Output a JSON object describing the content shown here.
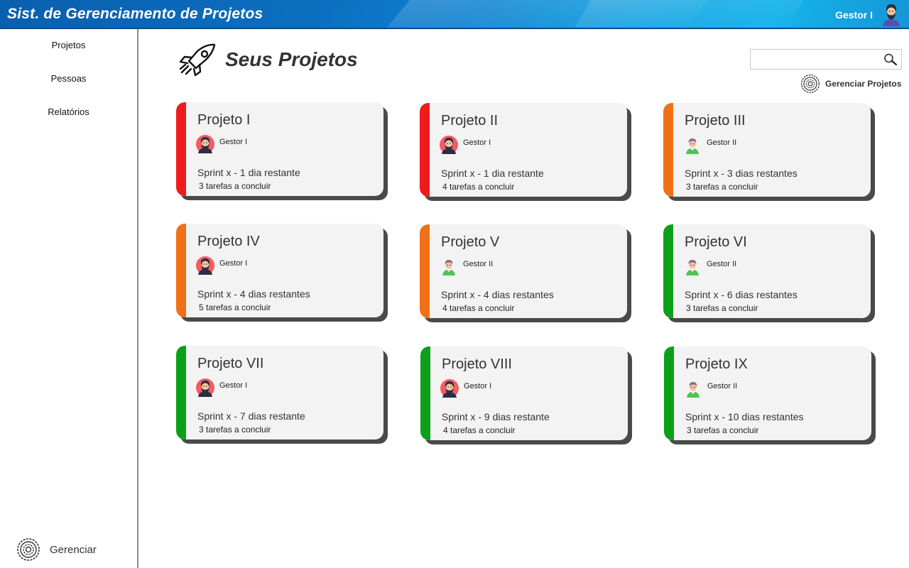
{
  "header": {
    "title": "Sist. de Gerenciamento de Projetos",
    "user_name": "Gestor I"
  },
  "sidebar": {
    "items": [
      {
        "label": "Projetos"
      },
      {
        "label": "Pessoas"
      },
      {
        "label": "Relatórios"
      }
    ],
    "footer_label": "Gerenciar"
  },
  "main": {
    "title": "Seus Projetos",
    "search": {
      "value": "",
      "placeholder": ""
    },
    "manage_label": "Gerenciar Projetos"
  },
  "colors": {
    "red": "#ee1c1c",
    "orange": "#f07018",
    "green": "#0ca01a"
  },
  "projects": [
    {
      "name": "Projeto I",
      "manager": "Gestor I",
      "avatar": "bearded-avatar-icon",
      "status": "red",
      "sprint": "Sprint x - 1 dia restante",
      "tasks": "3 tarefas a concluir"
    },
    {
      "name": "Projeto II",
      "manager": "Gestor I",
      "avatar": "bearded-avatar-icon",
      "status": "red",
      "sprint": "Sprint x - 1 dia restante",
      "tasks": "4 tarefas a concluir"
    },
    {
      "name": "Projeto III",
      "manager": "Gestor II",
      "avatar": "person-avatar-icon",
      "status": "orange",
      "sprint": "Sprint x - 3 dias restantes",
      "tasks": "3 tarefas a concluir"
    },
    {
      "name": "Projeto IV",
      "manager": "Gestor I",
      "avatar": "bearded-avatar-icon",
      "status": "orange",
      "sprint": "Sprint x - 4 dias restantes",
      "tasks": "5 tarefas a concluir"
    },
    {
      "name": "Projeto V",
      "manager": "Gestor II",
      "avatar": "person-avatar-icon",
      "status": "orange",
      "sprint": "Sprint x - 4 dias restantes",
      "tasks": "4 tarefas a concluir"
    },
    {
      "name": "Projeto VI",
      "manager": "Gestor II",
      "avatar": "person-avatar-icon",
      "status": "green",
      "sprint": "Sprint x - 6 dias restantes",
      "tasks": "3 tarefas a concluir"
    },
    {
      "name": "Projeto VII",
      "manager": "Gestor I",
      "avatar": "bearded-avatar-icon",
      "status": "green",
      "sprint": "Sprint x - 7 dias restante",
      "tasks": "3 tarefas a concluir"
    },
    {
      "name": "Projeto VIII",
      "manager": "Gestor I",
      "avatar": "bearded-avatar-icon",
      "status": "green",
      "sprint": "Sprint x - 9 dias restante",
      "tasks": "4 tarefas a concluir"
    },
    {
      "name": "Projeto IX",
      "manager": "Gestor II",
      "avatar": "person-avatar-icon",
      "status": "green",
      "sprint": "Sprint x - 10 dias restantes",
      "tasks": "3 tarefas a concluir"
    }
  ]
}
